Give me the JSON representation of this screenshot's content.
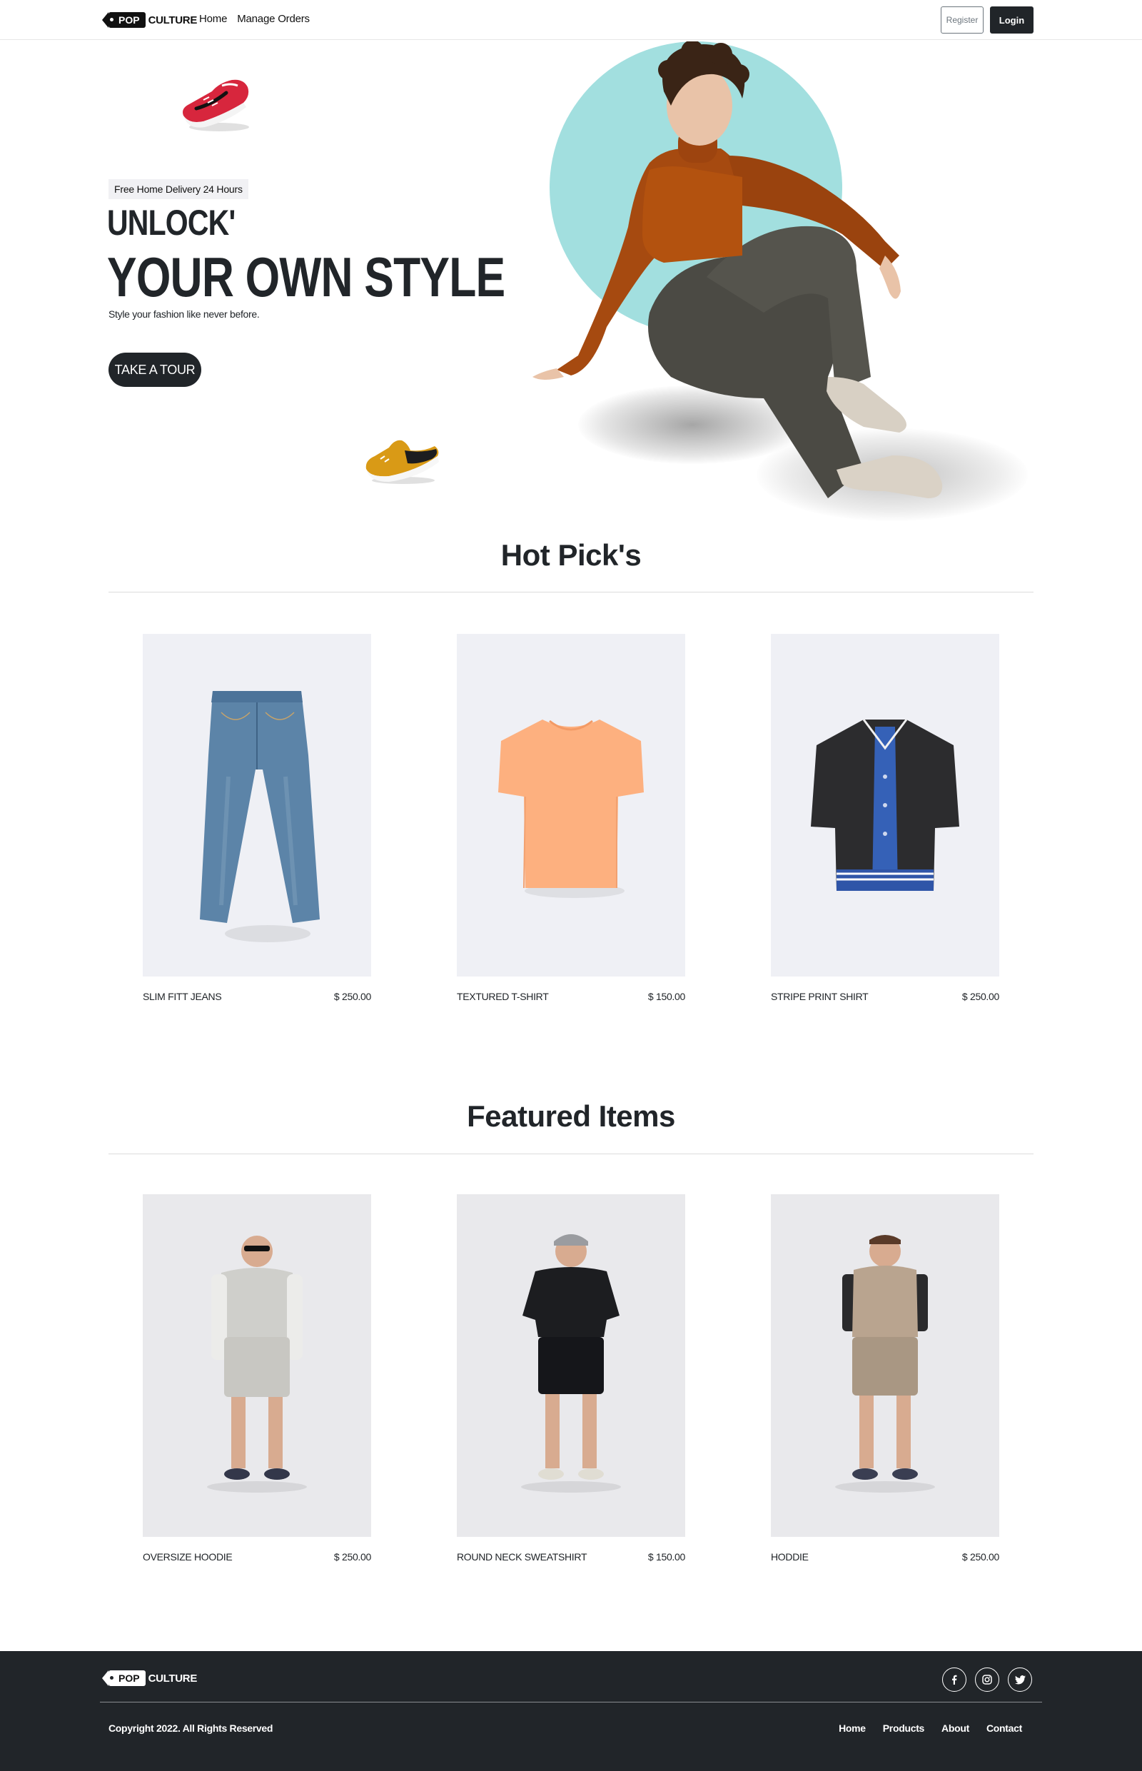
{
  "nav": {
    "brand_tag": "POP",
    "brand_word": "CULTURE",
    "links": [
      "Home",
      "Manage Orders"
    ],
    "register_label": "Register",
    "login_label": "Login"
  },
  "hero": {
    "badge": "Free Home Delivery 24 Hours",
    "title_line1": "UNLOCK'",
    "title_line2": "YOUR OWN STYLE",
    "subtitle": "Style your fashion like never before.",
    "cta_label": "TAKE A TOUR",
    "circle_color": "#a2dfdf"
  },
  "hot_picks": {
    "title": "Hot Pick's",
    "items": [
      {
        "name": "SLIM FITT JEANS",
        "price": "$ 250.00"
      },
      {
        "name": "TEXTURED T-SHIRT",
        "price": "$ 150.00"
      },
      {
        "name": "STRIPE PRINT SHIRT",
        "price": "$ 250.00"
      }
    ]
  },
  "featured": {
    "title": "Featured Items",
    "items": [
      {
        "name": "OVERSIZE HOODIE",
        "price": "$ 250.00"
      },
      {
        "name": "ROUND NECK SWEATSHIRT",
        "price": "$ 150.00"
      },
      {
        "name": "HODDIE",
        "price": "$ 250.00"
      }
    ]
  },
  "footer": {
    "brand_tag": "POP",
    "brand_word": "CULTURE",
    "socials": [
      "facebook-icon",
      "instagram-icon",
      "twitter-icon"
    ],
    "copyright": "Copyright 2022. All Rights Reserved",
    "links": [
      "Home",
      "Products",
      "About",
      "Contact"
    ],
    "background": "#212529"
  }
}
